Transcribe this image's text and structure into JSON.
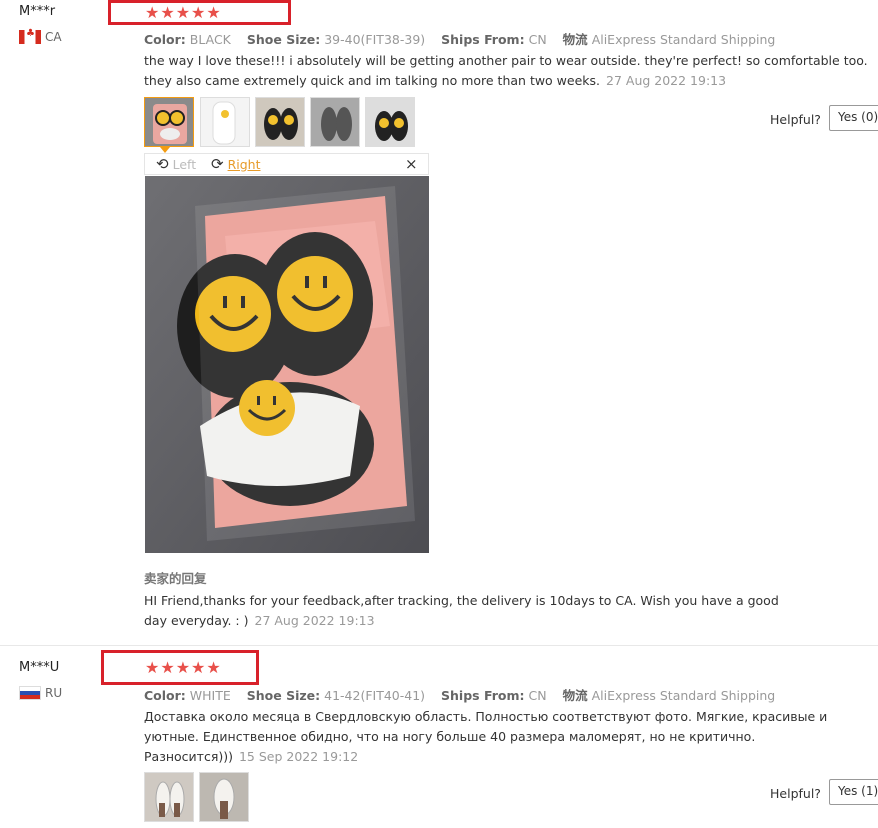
{
  "reviews": [
    {
      "user": "M***r",
      "country_code": "CA",
      "rating_stars": "★★★★★",
      "rating": 5,
      "color_label": "Color:",
      "color_value": "BLACK",
      "shoe_label": "Shoe Size:",
      "shoe_value": "39-40(FIT38-39)",
      "ships_label": "Ships From:",
      "ships_value": "CN",
      "logistics_label": "物流",
      "logistics_value": "AliExpress Standard Shipping",
      "text": "the way I love these!!! i absolutely will be getting another pair to wear outside. they're perfect! so comfortable too. they also came extremely quick and im talking no more than two weeks.",
      "date": "27 Aug 2022 19:13",
      "helpful_label": "Helpful?",
      "yes_label": "Yes (0)",
      "viewer": {
        "left_label": "Left",
        "right_label": "Right",
        "close": "×"
      },
      "reply_title": "卖家的回复",
      "reply_text": "HI Friend,thanks for your feedback,after tracking, the delivery is 10days to CA. Wish you have a good day everyday. : )",
      "reply_date": "27 Aug 2022 19:13"
    },
    {
      "user": "M***U",
      "country_code": "RU",
      "rating_stars": "★★★★★",
      "rating": 5,
      "color_label": "Color:",
      "color_value": "WHITE",
      "shoe_label": "Shoe Size:",
      "shoe_value": "41-42(FIT40-41)",
      "ships_label": "Ships From:",
      "ships_value": "CN",
      "logistics_label": "物流",
      "logistics_value": "AliExpress Standard Shipping",
      "text": "Доставка около месяца в Свердловскую область. Полностью соответствуют фото. Мягкие, красивые и уютные. Единственное обидно, что на ногу больше 40 размера маломерят, но не критично. Разносится)))",
      "date": "15 Sep 2022 19:12",
      "helpful_label": "Helpful?",
      "yes_label": "Yes (1)"
    }
  ]
}
